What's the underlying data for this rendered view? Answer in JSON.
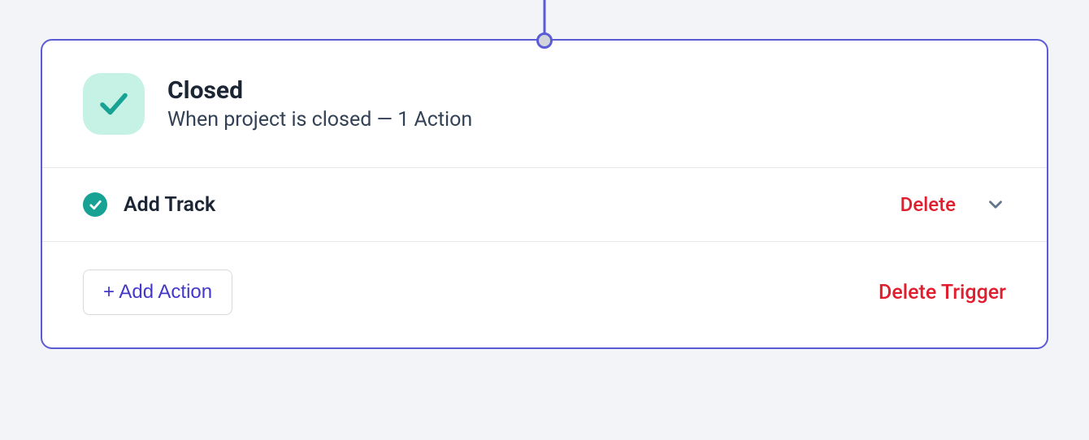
{
  "trigger": {
    "title": "Closed",
    "subtitle": "When project is closed — 1 Action",
    "actions": [
      {
        "name": "Add Track",
        "delete_label": "Delete"
      }
    ],
    "add_action_label": "+ Add Action",
    "delete_trigger_label": "Delete Trigger"
  }
}
